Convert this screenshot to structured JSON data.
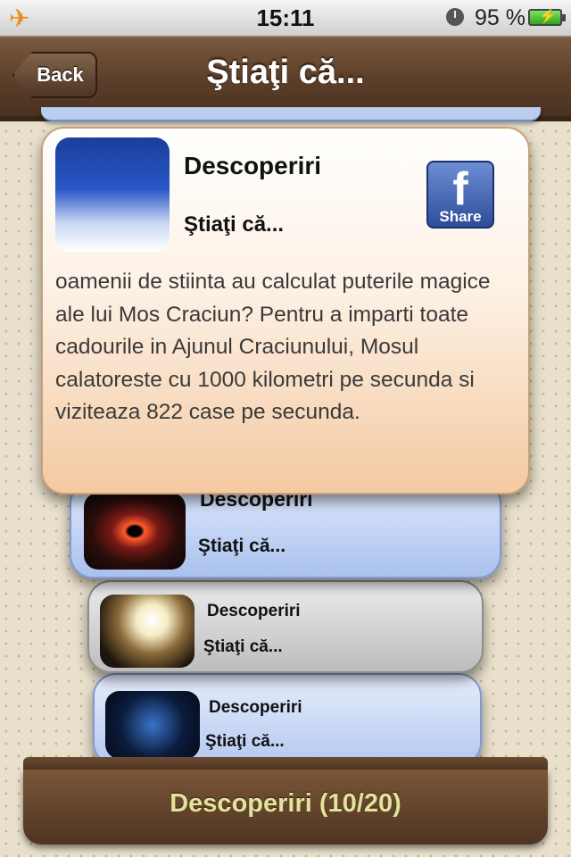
{
  "status_bar": {
    "time": "15:11",
    "battery_percent": "95 %"
  },
  "nav": {
    "back_label": "Back",
    "title": "Ştiaţi că..."
  },
  "main_card": {
    "title": "Descoperiri",
    "subtitle": "Ştiaţi că...",
    "share_label": "Share",
    "body": "oamenii de stiinta au calculat puterile magice ale lui Mos Craciun? Pentru a imparti toate cadourile in Ajunul Craciunului, Mosul calatoreste cu 1000 kilometri pe secunda si viziteaza 822 case pe secunda."
  },
  "stack_cards": [
    {
      "title": "Descoperiri",
      "subtitle": "Ştiaţi că..."
    },
    {
      "title": "Descoperiri",
      "subtitle": "Ştiaţi că..."
    },
    {
      "title": "Descoperiri",
      "subtitle": "Ştiaţi că..."
    }
  ],
  "drawer": {
    "label": "Descoperiri (10/20)"
  },
  "colors": {
    "nav_brown": "#5c3f2a",
    "drawer_label": "#e3e39a",
    "card_blue": "#a9c1ee",
    "card_peach": "#f3c9a1"
  }
}
